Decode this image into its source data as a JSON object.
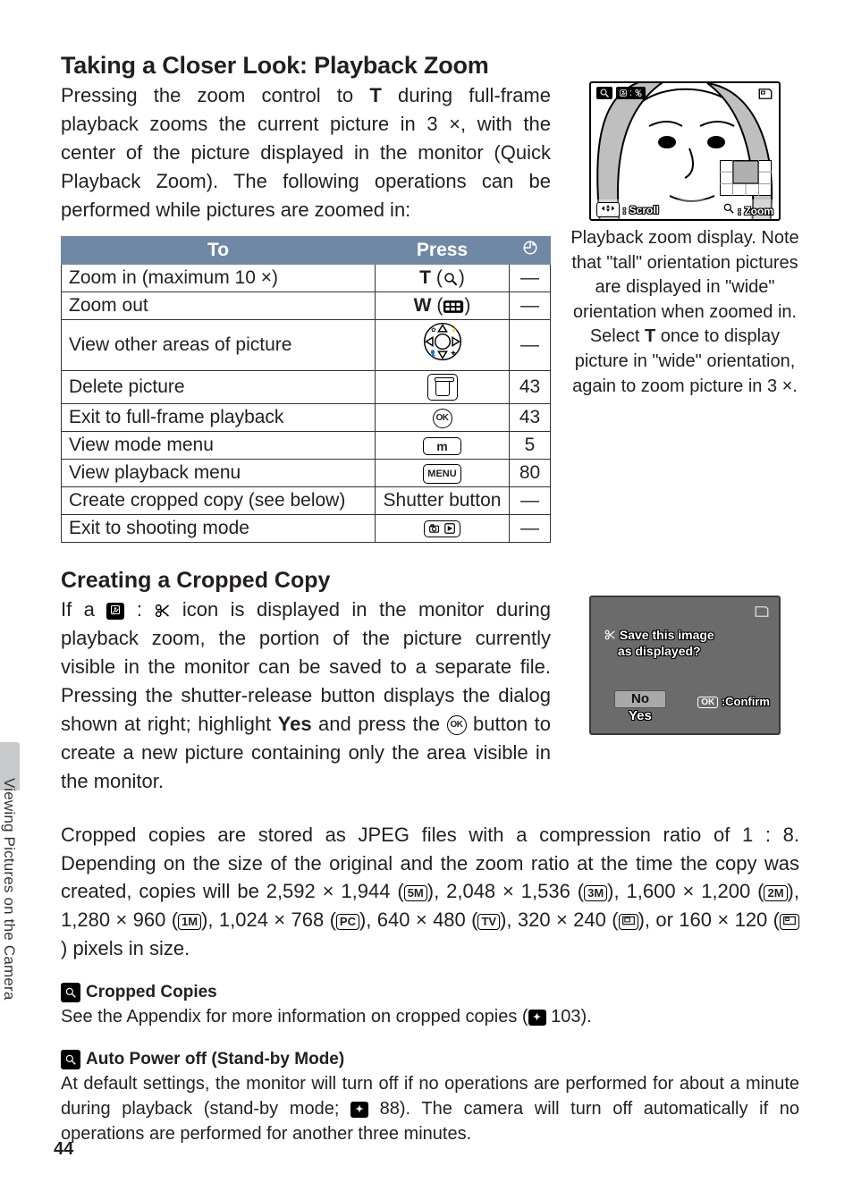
{
  "side_label": "Viewing Pictures on the Camera",
  "page_number": "44",
  "sec1": {
    "title": "Taking a Closer Look: Playback Zoom",
    "para_parts": {
      "a": "Pressing the zoom control to ",
      "t": "T",
      "b": " during full-frame playback zooms the current picture in 3 ×, with the center of the picture displayed in the monitor (Quick Playback Zoom).  The following operations can be performed while pictures are zoomed in:"
    }
  },
  "table": {
    "head": {
      "to": "To",
      "press": "Press",
      "ref": ""
    },
    "rows": [
      {
        "to": "Zoom in (maximum 10 ×)",
        "press_kind": "zoom_in",
        "press_label": "T",
        "ref": "—"
      },
      {
        "to": "Zoom out",
        "press_kind": "zoom_out",
        "press_label": "W",
        "ref": "—"
      },
      {
        "to": "View other areas of picture",
        "press_kind": "rosette",
        "ref": "—"
      },
      {
        "to": "Delete picture",
        "press_kind": "trash",
        "ref": "43"
      },
      {
        "to": "Exit to full-frame playback",
        "press_kind": "ok",
        "ref": "43"
      },
      {
        "to": "View mode menu",
        "press_kind": "mbtn",
        "press_label": "m",
        "ref": "5"
      },
      {
        "to": "View playback menu",
        "press_kind": "menubtn",
        "press_label": "MENU",
        "ref": "80"
      },
      {
        "to": "Create cropped copy (see below)",
        "press_kind": "text",
        "press_label": "Shutter button",
        "ref": "—"
      },
      {
        "to": "Exit to shooting mode",
        "press_kind": "camplay",
        "ref": "—"
      }
    ]
  },
  "screen1": {
    "caption_parts": {
      "a": "Playback zoom display.  Note that \"tall\" orientation pictures are displayed in \"wide\" orientation when zoomed in.  Select ",
      "t": "T",
      "b": " once to display picture in \"wide\" orientation, again to zoom picture in 3 ×."
    },
    "footer_scroll": ": Scroll",
    "footer_zoom": ": Zoom"
  },
  "sec2": {
    "title": "Creating a Cropped Copy",
    "para_parts": {
      "a": "If a ",
      "b": " icon is displayed in the monitor during playback zoom, the portion of the picture currently visible in the monitor can be saved to a separate file.  Pressing the shutter-release button displays the dialog shown at right; highlight ",
      "yes": "Yes",
      "c": " and press the ",
      "d": " button to create a new picture containing only the area visible in the monitor."
    }
  },
  "screen2": {
    "question_l1": "Save this image",
    "question_l2": "as displayed?",
    "opt_no": "No",
    "opt_yes": "Yes",
    "confirm": ":Confirm",
    "ok": "OK"
  },
  "sizes_para": {
    "a": "Cropped copies are stored as JPEG files with a compression ratio of 1 : 8.  Depending on the size of the original and the zoom ratio at the time the copy was created, copies will be 2,592 × 1,944 (",
    "s5": "5M",
    "b": "), 2,048 × 1,536 (",
    "s3": "3M",
    "c": "), 1,600 × 1,200 (",
    "s2": "2M",
    "d": "), 1,280 × 960 (",
    "s1": "1M",
    "e": "), 1,024 × 768 (",
    "spc": "PC",
    "f": "), 640 × 480 (",
    "stv": "TV",
    "g": "), 320 × 240 (",
    "h": "), or 160 × 120 (",
    "i": ") pixels in size."
  },
  "note1": {
    "title": "Cropped Copies",
    "body_a": "See the Appendix for more information on cropped copies (",
    "body_ref": " 103).",
    "body_b": ""
  },
  "note2": {
    "title": "Auto Power off (Stand-by Mode)",
    "body_a": "At default settings, the monitor will turn off if no operations are performed for about a minute during playback (stand-by mode; ",
    "body_ref": " 88).  The camera will turn off automatically if no operations are performed for another three minutes."
  }
}
